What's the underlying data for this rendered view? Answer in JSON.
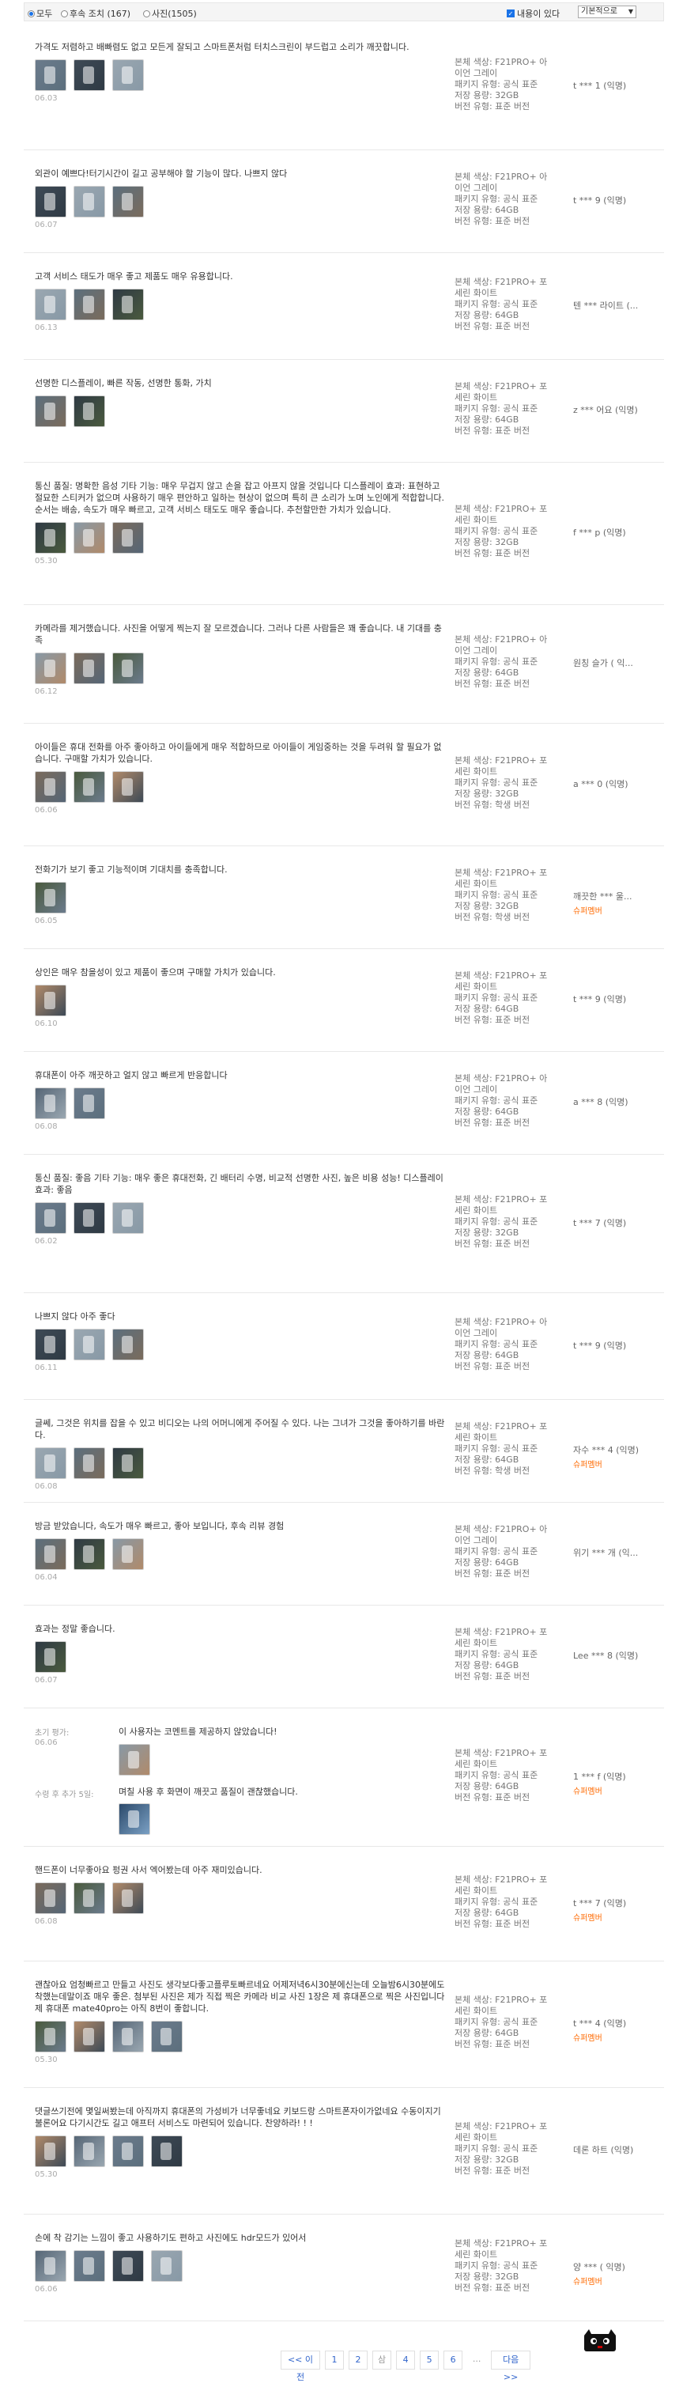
{
  "filter": {
    "all_label": "모두",
    "follow_label": "후속 조치 (167)",
    "photo_label": "사진(1505)",
    "content_label": "내용이 있다",
    "sort_label": "기본적으로"
  },
  "reviews": [
    {
      "text": "가격도 저렴하고 배빠렴도 없고 모든게 잘되고 스마트폰처럼 터치스크린이 부드럽고 소리가 깨끗합니다.",
      "date": "06.03",
      "meta": [
        "본체 색상: F21PRO+ 아",
        "이언 그레이",
        "패키지 유형: 공식 표준",
        "저장 용량: 32GB",
        "버전 유형: 표준 버전"
      ],
      "user": "t *** 1 (익명)",
      "vip": ""
    },
    {
      "text": "외관이 예쁘다!터기시간이 길고 공부해야 할 기능이 많다. 나쁘지 않다",
      "date": "06.07",
      "meta": [
        "본체 색상: F21PRO+ 아",
        "이언 그레이",
        "패키지 유형: 공식 표준",
        "저장 용량: 64GB",
        "버전 유형: 표준 버전"
      ],
      "user": "t *** 9 (익명)",
      "vip": ""
    },
    {
      "text": "고객 서비스 태도가 매우 좋고 제품도 매우 유용합니다.",
      "date": "06.13",
      "meta": [
        "본체 색상: F21PRO+ 포",
        "세린 화이트",
        "패키지 유형: 공식 표준",
        "저장 용량: 64GB",
        "버전 유형: 표준 버전"
      ],
      "user": "텐 *** 라이트 (...",
      "vip": ""
    },
    {
      "text": "선명한 디스플레이, 빠른 작동, 선명한 통화, 가치",
      "date": "",
      "meta": [
        "본체 색상: F21PRO+ 포",
        "세린 화이트",
        "패키지 유형: 공식 표준",
        "저장 용량: 64GB",
        "버전 유형: 표준 버전"
      ],
      "user": "z *** 어요 (익명)",
      "vip": ""
    },
    {
      "text": "통신 품질: 명확한 음성 기타 기능: 매우 무겁지 않고 손을 잡고 아프지 않을 것입니다 디스플레이 효과: 표현하고 절묘한 스티커가 없으며 사용하기 매우 편안하고 일하는 현상이 없으며 특히 큰 소리가 노며 노인에게 적합합니다. 순서는 배송, 속도가 매우 빠르고, 고객 서비스 태도도 매우 좋습니다. 추천할만한 가치가 있습니다.",
      "date": "05.30",
      "meta": [
        "본체 색상: F21PRO+ 포",
        "세린 화이트",
        "패키지 유형: 공식 표준",
        "저장 용량: 32GB",
        "버전 유형: 표준 버전"
      ],
      "user": "f *** p (익명)",
      "vip": ""
    },
    {
      "text": "카메라를 제거했습니다. 사진을 어떻게 찍는지 잘 모르겠습니다. 그러나 다른 사람들은 꽤 좋습니다. 내 기대를 충족",
      "date": "06.12",
      "meta": [
        "본체 색상: F21PRO+ 아",
        "이언 그레이",
        "패키지 유형: 공식 표준",
        "저장 용량: 64GB",
        "버전 유형: 표준 버전"
      ],
      "user": "원칭 슬가 ( 익...",
      "vip": ""
    },
    {
      "text": "아이들은 휴대 전화를 아주 좋아하고 아이들에게 매우 적합하므로 아이들이 게임중하는 것을 두려워 할 필요가 없습니다. 구매할 가치가 있습니다.",
      "date": "06.06",
      "meta": [
        "본체 색상: F21PRO+ 포",
        "세린 화이트",
        "패키지 유형: 공식 표준",
        "저장 용량: 32GB",
        "버전 유형: 학생 버전"
      ],
      "user": "a *** 0 (익명)",
      "vip": ""
    },
    {
      "text": "전화기가 보기 좋고 기능적이며 기대치를 충족합니다.",
      "date": "06.05",
      "meta": [
        "본체 색상: F21PRO+ 포",
        "세린 화이트",
        "패키지 유형: 공식 표준",
        "저장 용량: 32GB",
        "버전 유형: 학생 버전"
      ],
      "user": "깨끗한 *** 울...",
      "vip": "슈퍼멤버"
    },
    {
      "text": "상인은 매우 참을성이 있고 제품이 좋으며 구매할 가치가 있습니다.",
      "date": "06.10",
      "meta": [
        "본체 색상: F21PRO+ 포",
        "세린 화이트",
        "패키지 유형: 공식 표준",
        "저장 용량: 64GB",
        "버전 유형: 표준 버전"
      ],
      "user": "t *** 9 (익명)",
      "vip": ""
    },
    {
      "text": "휴대폰이 아주 깨끗하고 얼지 않고 빠르게 반응합니다",
      "date": "06.08",
      "meta": [
        "본체 색상: F21PRO+ 아",
        "이언 그레이",
        "패키지 유형: 공식 표준",
        "저장 용량: 64GB",
        "버전 유형: 표준 버전"
      ],
      "user": "a *** 8 (익명)",
      "vip": ""
    },
    {
      "text": "통신 품질: 좋음 기타 기능: 매우 좋은 휴대전화, 긴 배터리 수명, 비교적 선명한 사진, 높은 비용 성능! 디스플레이 효과: 좋음",
      "date": "06.02",
      "meta": [
        "본체 색상: F21PRO+ 포",
        "세린 화이트",
        "패키지 유형: 공식 표준",
        "저장 용량: 32GB",
        "버전 유형: 표준 버전"
      ],
      "user": "t *** 7 (익명)",
      "vip": ""
    },
    {
      "text": "나쁘지 않다 아주 좋다",
      "date": "06.11",
      "meta": [
        "본체 색상: F21PRO+ 아",
        "이언 그레이",
        "패키지 유형: 공식 표준",
        "저장 용량: 64GB",
        "버전 유형: 표준 버전"
      ],
      "user": "t *** 9 (익명)",
      "vip": ""
    },
    {
      "text": "글쎄, 그것은 위치를 잡을 수 있고 비디오는 나의 어머니에게 주어질 수 있다. 나는 그녀가 그것을 좋아하기를 바란다.",
      "date": "06.08",
      "meta": [
        "본체 색상: F21PRO+ 포",
        "세린 화이트",
        "패키지 유형: 공식 표준",
        "저장 용량: 64GB",
        "버전 유형: 학생 버전"
      ],
      "user": "자수 *** 4 (익명)",
      "vip": "슈퍼멤버"
    },
    {
      "text": "방금 받았습니다, 속도가 매우 빠르고, 좋아 보입니다, 후속 리뷰 경험",
      "date": "06.04",
      "meta": [
        "본체 색상: F21PRO+ 아",
        "이언 그레이",
        "패키지 유형: 공식 표준",
        "저장 용량: 64GB",
        "버전 유형: 표준 버전"
      ],
      "user": "위기 *** 개 (익...",
      "vip": ""
    },
    {
      "text": "효과는 정말 좋습니다.",
      "date": "06.07",
      "meta": [
        "본체 색상: F21PRO+ 포",
        "세린 화이트",
        "패키지 유형: 공식 표준",
        "저장 용량: 64GB",
        "버전 유형: 표준 버전"
      ],
      "user": "Lee *** 8 (익명)",
      "vip": ""
    },
    {
      "text": "이 사용자는 코멘트를 제공하지 않았습니다!",
      "label1": "초기 평가:",
      "date": "06.06",
      "label2": "수령 후 추가 5일:",
      "text2": "며칠 사용 후 화면이 깨끗고 품질이 괜찮했습니다.",
      "meta": [
        "본체 색상: F21PRO+ 포",
        "세린 화이트",
        "패키지 유형: 공식 표준",
        "저장 용량: 64GB",
        "버전 유형: 표준 버전"
      ],
      "user": "1 *** f (익명)",
      "vip": "슈퍼멤버"
    },
    {
      "text": "핸드폰이 너무좋아요 펑권 사서 엑어봤는데 아주 재미있습니다.",
      "date": "06.08",
      "meta": [
        "본체 색상: F21PRO+ 포",
        "세린 화이트",
        "패키지 유형: 공식 표준",
        "저장 용량: 64GB",
        "버전 유형: 표준 버전"
      ],
      "user": "t *** 7 (익명)",
      "vip": "슈퍼멤버"
    },
    {
      "text": "괜찮아요 엄청빠르고 만들고 사진도 생각보다좋고플루토빠르네요 어제저녁6시30분에신는데 오늘밤6시30분에도착했는데말이죠 매우 좋은. 첨부된 사진은 제가 직접 찍은 카메라 비교 사진 1장은 제 휴대폰으로 찍은 사진입니다 제 휴대폰 mate40pro는 아직 8번이 좋합니다.",
      "date": "05.30",
      "meta": [
        "본체 색상: F21PRO+ 포",
        "세린 화이트",
        "패키지 유형: 공식 표준",
        "저장 용량: 64GB",
        "버전 유형: 표준 버전"
      ],
      "user": "t *** 4 (익명)",
      "vip": "슈퍼멤버"
    },
    {
      "text": "댓글쓰기전에 몇일써봤는데 아직까지 휴대폰의 가성비가 너무좋네요 키보드랑 스마트폰자이가없네요 수동이지기 불론어요 다기시간도 길고 애프터 서비스도 마련되어 있습니다. 찬양하라! ! !",
      "date": "05.30",
      "meta": [
        "본체 색상: F21PRO+ 포",
        "세린 화이트",
        "패키지 유형: 공식 표준",
        "저장 용량: 32GB",
        "버전 유형: 표준 버전"
      ],
      "user": "데론 하트 (익명)",
      "vip": ""
    },
    {
      "text": "손에 착 감기는 느낌이 좋고 사용하기도 편하고 사진에도 hdr모드가 있어서",
      "date": "06.06",
      "meta": [
        "본체 색상: F21PRO+ 포",
        "세린 화이트",
        "패키지 유형: 공식 표준",
        "저장 용량: 32GB",
        "버전 유형: 표준 버전"
      ],
      "user": "양 *** ( 익명)",
      "vip": "슈퍼멤버"
    }
  ],
  "pager": {
    "prev": "<< 이전",
    "p1": "1",
    "p2": "2",
    "p3": "삼",
    "p4": "4",
    "p5": "5",
    "p6": "6",
    "dots": "...",
    "next": "다음 >>"
  }
}
